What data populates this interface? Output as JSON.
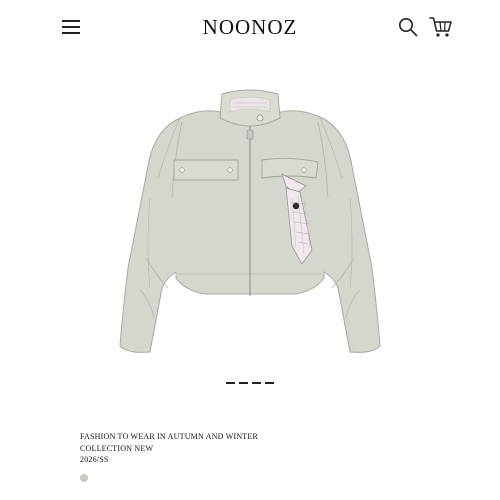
{
  "header": {
    "logo": "NOONOZ",
    "icons": [
      "menu-icon",
      "search-icon",
      "cart-icon"
    ]
  },
  "product": {
    "image_icon": "jacket-illustration",
    "colors": {
      "jacket": "#d5d7cf",
      "accent": "#2b2b2b"
    }
  },
  "carousel": {
    "slides": 4
  },
  "caption": {
    "line1": "FASHION TO WEAR IN AUTUMN AND WINTER",
    "line2": "COLLECTION NEW",
    "line3": "2026/SS"
  },
  "swatches": [
    {
      "color": "#c9cbc4"
    }
  ]
}
